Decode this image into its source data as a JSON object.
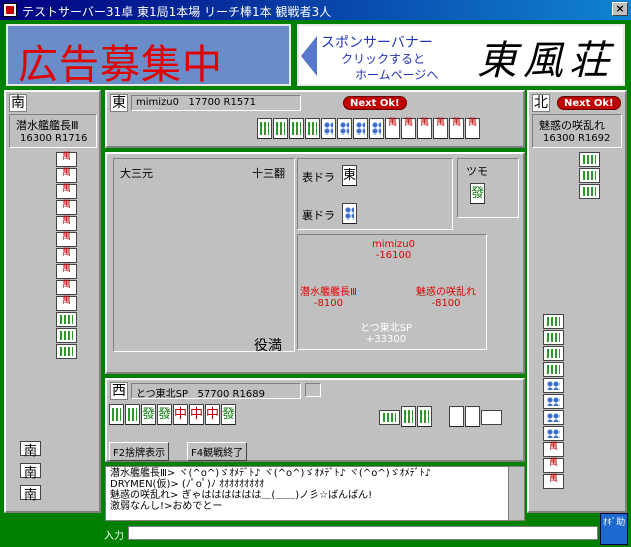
{
  "window": {
    "title": "テストサーバー31卓 東1局1本場 リーチ棒1本  観戦者3人",
    "close_label": "×"
  },
  "ads": {
    "left_text": "広告募集中",
    "right_line1": "スポンサーバナー",
    "right_line2": "クリックすると",
    "right_line3": "ホームページへ",
    "right_logo": "東風荘"
  },
  "players": {
    "east": {
      "seat": "東",
      "name": "mimizu0",
      "points": "17700",
      "rating": "R1571",
      "status": "Next Ok!"
    },
    "south": {
      "seat": "南",
      "name": "潜水艦艦長Ⅲ",
      "points": "16300",
      "rating": "R1716"
    },
    "north": {
      "seat": "北",
      "name": "魅惑の咲乱れ",
      "points": "16300",
      "rating": "R1692",
      "status": "Next Ok!"
    },
    "west": {
      "seat": "西",
      "name": "とつ東北SP",
      "points": "57700",
      "rating": "R1689"
    }
  },
  "result": {
    "yaku": "大三元",
    "han": "十三翻",
    "omote_label": "表ドラ",
    "omote_tile": "東",
    "ura_label": "裏ドラ",
    "tsumo_label": "ツモ",
    "tsumo_tile": "發",
    "limit": "役満",
    "scores": [
      {
        "name": "mimizu0",
        "delta": "-16100",
        "color": "#e00000"
      },
      {
        "name": "潜水艦艦長Ⅲ",
        "delta": "-8100",
        "color": "#e00000"
      },
      {
        "name": "魅惑の咲乱れ",
        "delta": "-8100",
        "color": "#e00000"
      },
      {
        "name": "とつ東北SP",
        "delta": "+33300",
        "color": "#ffffff"
      }
    ]
  },
  "west_hand": {
    "tiles": [
      "發",
      "發",
      "中",
      "中",
      "中",
      "發"
    ]
  },
  "south_melds": [
    "南",
    "南",
    "南"
  ],
  "buttons": {
    "f2": "F2捨牌表示",
    "f4": "F4観戦終了"
  },
  "chat": {
    "lines": [
      "潜水艦艦長Ⅲ> ヾ(^o^)ゞｵﾒﾃﾞﾄ♪ ヾ(^o^)ゞｵﾒﾃﾞﾄ♪ ヾ(^o^)ゞｵﾒﾃﾞﾄ♪",
      "DRYMEN(仮)> (ﾉﾟoﾟ)ﾉ ｵｵｵｵｵｵｵｵｵ",
      "魅惑の咲乱れ> ぎゃはははははは＿(＿＿)ノ彡☆ばんばん!",
      "激弱なんし!>おめでとー"
    ],
    "input_label": "入力",
    "input_value": ""
  },
  "footer_icon": "ｵｷﾞ助",
  "colors": {
    "felt": "#008000",
    "panel": "#c0c0c0",
    "accent_red": "#c00000",
    "title_blue": "#000080"
  }
}
